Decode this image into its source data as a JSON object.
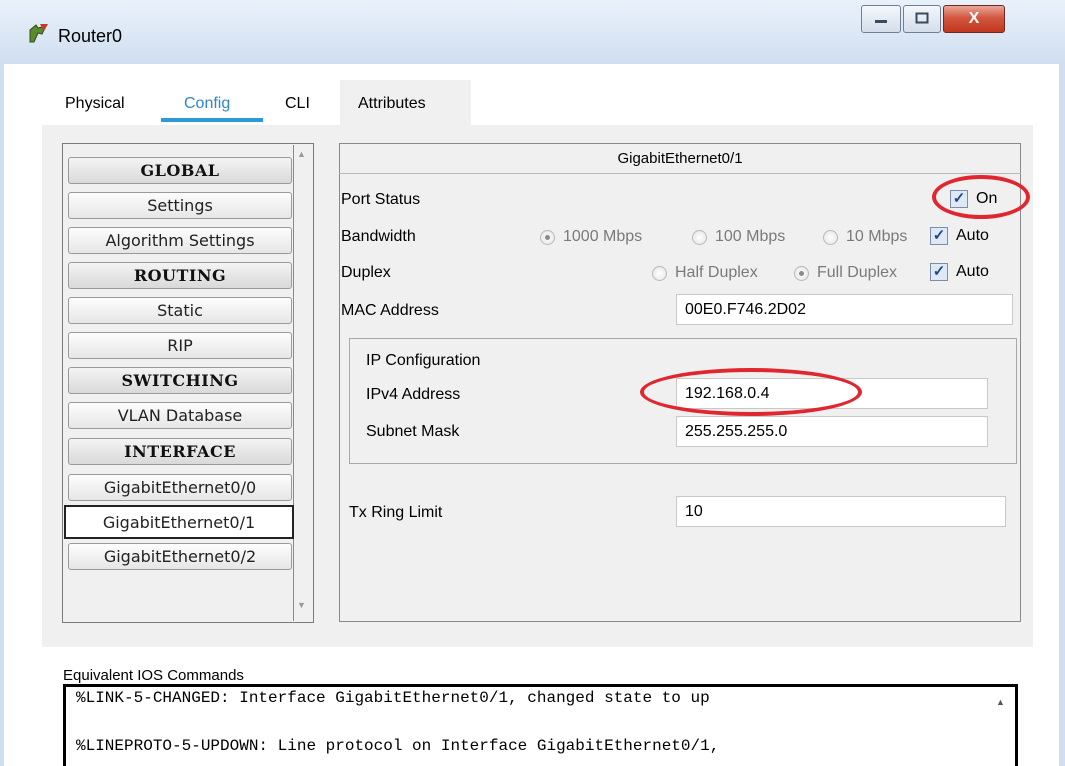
{
  "window": {
    "title": "Router0",
    "controls": {
      "minimize": "—",
      "maximize": "□",
      "close": "X"
    }
  },
  "tabs": [
    {
      "label": "Physical",
      "active": false
    },
    {
      "label": "Config",
      "active": true
    },
    {
      "label": "CLI",
      "active": false
    },
    {
      "label": "Attributes",
      "active": false
    }
  ],
  "sidebar": {
    "items": [
      {
        "label": "GLOBAL",
        "header": true
      },
      {
        "label": "Settings"
      },
      {
        "label": "Algorithm Settings"
      },
      {
        "label": "ROUTING",
        "header": true
      },
      {
        "label": "Static"
      },
      {
        "label": "RIP"
      },
      {
        "label": "SWITCHING",
        "header": true
      },
      {
        "label": "VLAN Database"
      },
      {
        "label": "INTERFACE",
        "header": true
      },
      {
        "label": "GigabitEthernet0/0"
      },
      {
        "label": "GigabitEthernet0/1",
        "selected": true
      },
      {
        "label": "GigabitEthernet0/2"
      }
    ]
  },
  "interface_panel": {
    "title": "GigabitEthernet0/1",
    "port_status": {
      "label": "Port Status",
      "on_label": "On",
      "checked": true
    },
    "bandwidth": {
      "label": "Bandwidth",
      "options": [
        "1000 Mbps",
        "100 Mbps",
        "10 Mbps"
      ],
      "selected": "1000 Mbps",
      "auto_label": "Auto",
      "auto_checked": true
    },
    "duplex": {
      "label": "Duplex",
      "options": [
        "Half Duplex",
        "Full Duplex"
      ],
      "selected": "Full Duplex",
      "auto_label": "Auto",
      "auto_checked": true
    },
    "mac": {
      "label": "MAC Address",
      "value": "00E0.F746.2D02"
    },
    "ip_config": {
      "heading": "IP Configuration",
      "ipv4_label": "IPv4 Address",
      "ipv4_value": "192.168.0.4",
      "mask_label": "Subnet Mask",
      "mask_value": "255.255.255.0"
    },
    "tx_ring": {
      "label": "Tx Ring Limit",
      "value": "10"
    }
  },
  "ios": {
    "label": "Equivalent IOS Commands",
    "lines": [
      "%LINK-5-CHANGED: Interface GigabitEthernet0/1, changed state to up",
      "",
      "%LINEPROTO-5-UPDOWN: Line protocol on Interface GigabitEthernet0/1,"
    ]
  },
  "colors": {
    "accent": "#2b9ad6",
    "highlight_oval": "#e0262f",
    "close_button": "#c2371f"
  }
}
